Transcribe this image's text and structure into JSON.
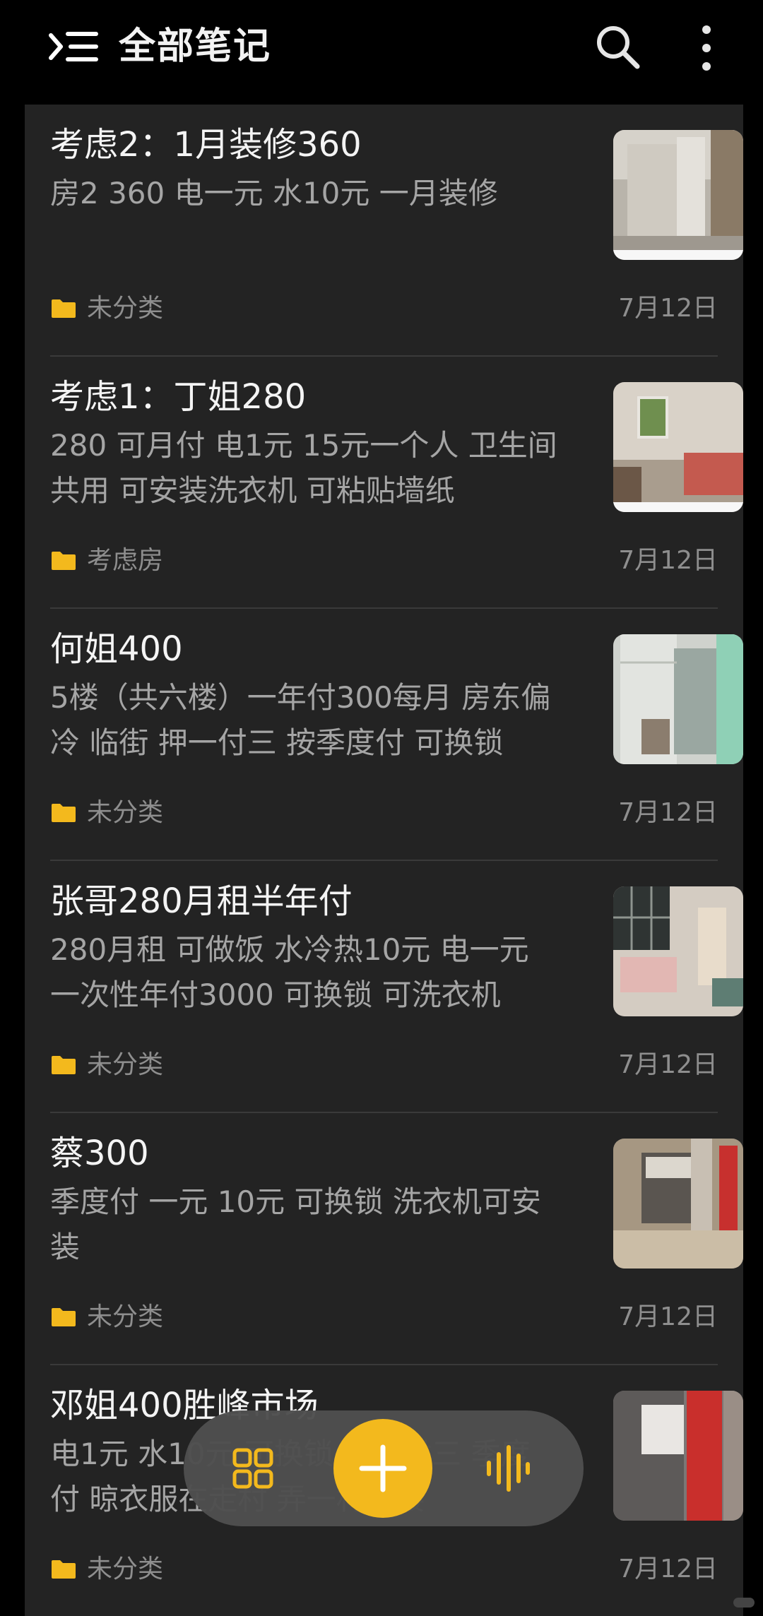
{
  "header": {
    "title": "全部笔记",
    "menu_icon": "menu-expand-icon",
    "search_icon": "search-icon",
    "more_icon": "more-vertical-icon"
  },
  "colors": {
    "background": "#000000",
    "card_background": "#232323",
    "accent": "#f3b91d",
    "title_text": "#f4f4f4",
    "body_text": "#a5a5a5",
    "meta_text": "#8e8e8e"
  },
  "notes": [
    {
      "title": "考虑2：1月装修360",
      "body": "房2 360 电一元 水10元 一月装修",
      "folder": "未分类",
      "date": "7月12日"
    },
    {
      "title": "考虑1：丁姐280",
      "body": "280 可月付 电1元 15元一个人 卫生间共用 可安装洗衣机 可粘贴墙纸",
      "folder": "考虑房",
      "date": "7月12日"
    },
    {
      "title": "何姐400",
      "body": "5楼（共六楼）一年付300每月 房东偏冷 临街 押一付三 按季度付 可换锁",
      "folder": "未分类",
      "date": "7月12日"
    },
    {
      "title": "张哥280月租半年付",
      "body": "280月租 可做饭 水冷热10元 电一元 一次性年付3000 可换锁 可洗衣机",
      "folder": "未分类",
      "date": "7月12日"
    },
    {
      "title": "蔡300",
      "body": "季度付 一元 10元 可换锁 洗衣机可安装",
      "folder": "未分类",
      "date": "7月12日"
    },
    {
      "title": "邓姐400胜峰市场",
      "body": "电1元 水10元 可换锁 押一付三 季度付 晾衣服在走村 弄一村上楼",
      "folder": "未分类",
      "date": "7月12日"
    }
  ],
  "bottom_bar": {
    "grid_icon": "grid-view-icon",
    "add_icon": "plus-icon",
    "voice_icon": "voice-wave-icon"
  }
}
